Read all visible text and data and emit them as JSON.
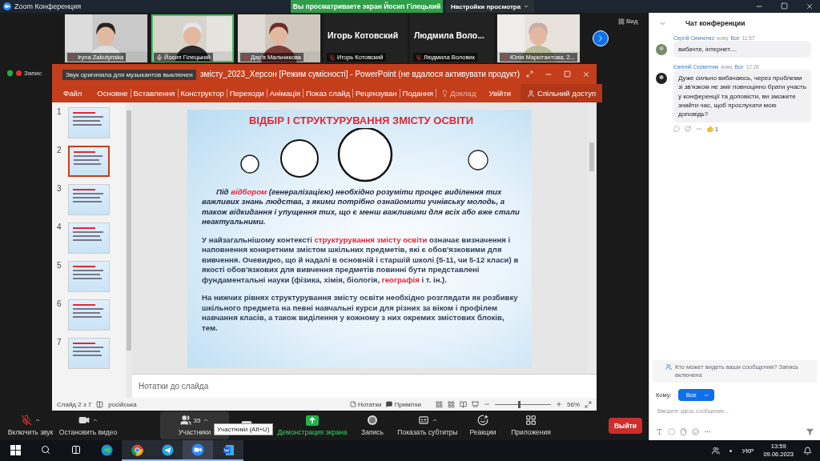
{
  "app": {
    "title": "Zoom Конференция"
  },
  "share_banner": {
    "text": "Вы просматриваете экран Йосип Гілецький"
  },
  "view_settings": {
    "label": "Настройки просмотра"
  },
  "participants_strip": [
    {
      "kind": "video",
      "name": "Iryna Zakutynska",
      "muted": true,
      "speaking": false
    },
    {
      "kind": "video",
      "name": "Йосип Гілецький",
      "muted": false,
      "speaking": true
    },
    {
      "kind": "video",
      "name": "Дар'я Мальчикова",
      "muted": true,
      "speaking": false
    },
    {
      "kind": "name",
      "display": "Игорь Котовский",
      "name": "Игорь Котовский",
      "muted": true,
      "speaking": false
    },
    {
      "kind": "name",
      "display": "Людмила Воло...",
      "name": "Людмила Воловик",
      "muted": true,
      "speaking": false
    },
    {
      "kind": "video",
      "name": "Юлія Маркітантова, 2...",
      "muted": true,
      "speaking": false
    }
  ],
  "view_button": {
    "label": "Вид"
  },
  "recording": {
    "label": "Запис"
  },
  "audio_tooltip": "Звук оригинала для музыкантов выключен",
  "powerpoint": {
    "title": "змісту_2023_Херсон [Режим сумісності] - PowerPoint (не вдалося активувати продукт)",
    "tabs": [
      "Файл",
      "Основне",
      "Вставлення",
      "Конструктор",
      "Переходи",
      "Анімація",
      "Показ слайд",
      "Рецензуван",
      "Подання"
    ],
    "tell_me": "Доклад",
    "sign_in": "Увійти",
    "share": "Спільний доступ",
    "slides": [
      {
        "number": "1",
        "selected": false
      },
      {
        "number": "2",
        "selected": true
      },
      {
        "number": "3",
        "selected": false
      },
      {
        "number": "4",
        "selected": false
      },
      {
        "number": "5",
        "selected": false
      },
      {
        "number": "6",
        "selected": false
      },
      {
        "number": "7",
        "selected": false
      }
    ],
    "slide": {
      "title": "ВІДБІР І СТРУКТУРУВАННЯ ЗМІСТУ ОСВІТИ",
      "paragraphs": [
        {
          "kind": "italic",
          "segments": [
            {
              "text": "Під ",
              "highlight": false
            },
            {
              "text": "відбором",
              "highlight": true
            },
            {
              "text": " (генералізацією) необхідно розуміти процес виділення тих важливих знань людства, з якими потрібно ознайомити учнівську молодь, а також відкидання і упущення тих, що є менш важливими для всіх або вже стали неактуальними.",
              "highlight": false
            }
          ]
        },
        {
          "kind": "plain",
          "segments": [
            {
              "text": "У найзагальнішому контексті ",
              "highlight": false
            },
            {
              "text": "структурування змісту освіти",
              "highlight": true
            },
            {
              "text": " означає визначення і наповнення конкретним змістом шкільних предметів, які є обов'язковими для вивчення. Очевидно, що й надалі в основній і старшій школі (5-11, чи 5-12 класи) в якості обов'язкових для вивчення предметів повинні бути представлені фундаментальні науки (фізика, хімія, біологія, ",
              "highlight": false
            },
            {
              "text": "географія",
              "highlight": true
            },
            {
              "text": " і т. ін.).",
              "highlight": false
            }
          ]
        },
        {
          "kind": "plain",
          "segments": [
            {
              "text": "На нижчих рівнях структурування змісту освіти необхідно розглядати як розбивку шкільного предмета на певні навчальні курси для різних за віком і профілем навчання класів, а також виділення у кожному з них окремих змістових блоків, тем.",
              "highlight": false
            }
          ]
        }
      ]
    },
    "notes_placeholder": "Нотатки до слайда",
    "status": {
      "slide_info": "Слайд 2 з 7",
      "language": "російська",
      "notes": "Нотатки",
      "comments": "Примітки",
      "zoom": {
        "level": 0.42,
        "reading": "56%"
      }
    }
  },
  "toolbar": [
    {
      "kind": "mic",
      "label": "Включить звук",
      "caret": true,
      "highlighted": false
    },
    {
      "kind": "video",
      "label": "Остановить видео",
      "caret": true,
      "highlighted": false
    },
    {
      "kind": "participants",
      "label": "Участники",
      "count": "35",
      "caret": true,
      "highlighted": true
    },
    {
      "kind": "chat",
      "caret": true,
      "highlighted": false
    },
    {
      "kind": "share",
      "label": "Демонстрация экрана",
      "caret": false,
      "highlighted": false
    },
    {
      "kind": "record",
      "label": "Запись",
      "caret": false,
      "highlighted": false
    },
    {
      "kind": "captions",
      "label": "Показать субтитры",
      "caret": true,
      "highlighted": false
    },
    {
      "kind": "reactions",
      "label": "Реакции",
      "caret": false,
      "highlighted": false
    },
    {
      "kind": "apps",
      "label": "Приложения",
      "caret": false,
      "highlighted": false
    }
  ],
  "toolbar_tooltip": "Участники (Alt+U)",
  "leave_button": "Выйти",
  "chat": {
    "title": "Чат конференции",
    "messages": [
      {
        "sender": "Сергій Симченко",
        "to": "кому",
        "recipient": "Все",
        "time": "11:57",
        "text": "вибачте, інтернет...."
      },
      {
        "sender": "Євгеній Серветник",
        "to": "кому",
        "recipient": "Все",
        "time": "12:26",
        "text": "Дуже сильно вибачаюсь, через проблеми зі зв'язком не зміг повноцінно брати участь у конференції та доповісти, ви зможете знайти час, щоб прослухати мою доповідь?",
        "reaction_count": "1"
      }
    ],
    "notice": "Кто может видеть ваши сообщения? Запись включена",
    "to_label": "Кому:",
    "recipient": "Все",
    "placeholder": "Введите здесь сообщение..."
  },
  "taskbar": {
    "apps": [
      {
        "kind": "edge",
        "open": false,
        "active": false
      },
      {
        "kind": "chrome",
        "open": true,
        "active": false
      },
      {
        "kind": "telegram",
        "open": true,
        "active": false
      },
      {
        "kind": "zoom",
        "open": true,
        "active": true
      },
      {
        "kind": "word",
        "open": true,
        "active": false
      }
    ],
    "language": "УКР",
    "time": "13:59",
    "date": "09.06.2023"
  }
}
